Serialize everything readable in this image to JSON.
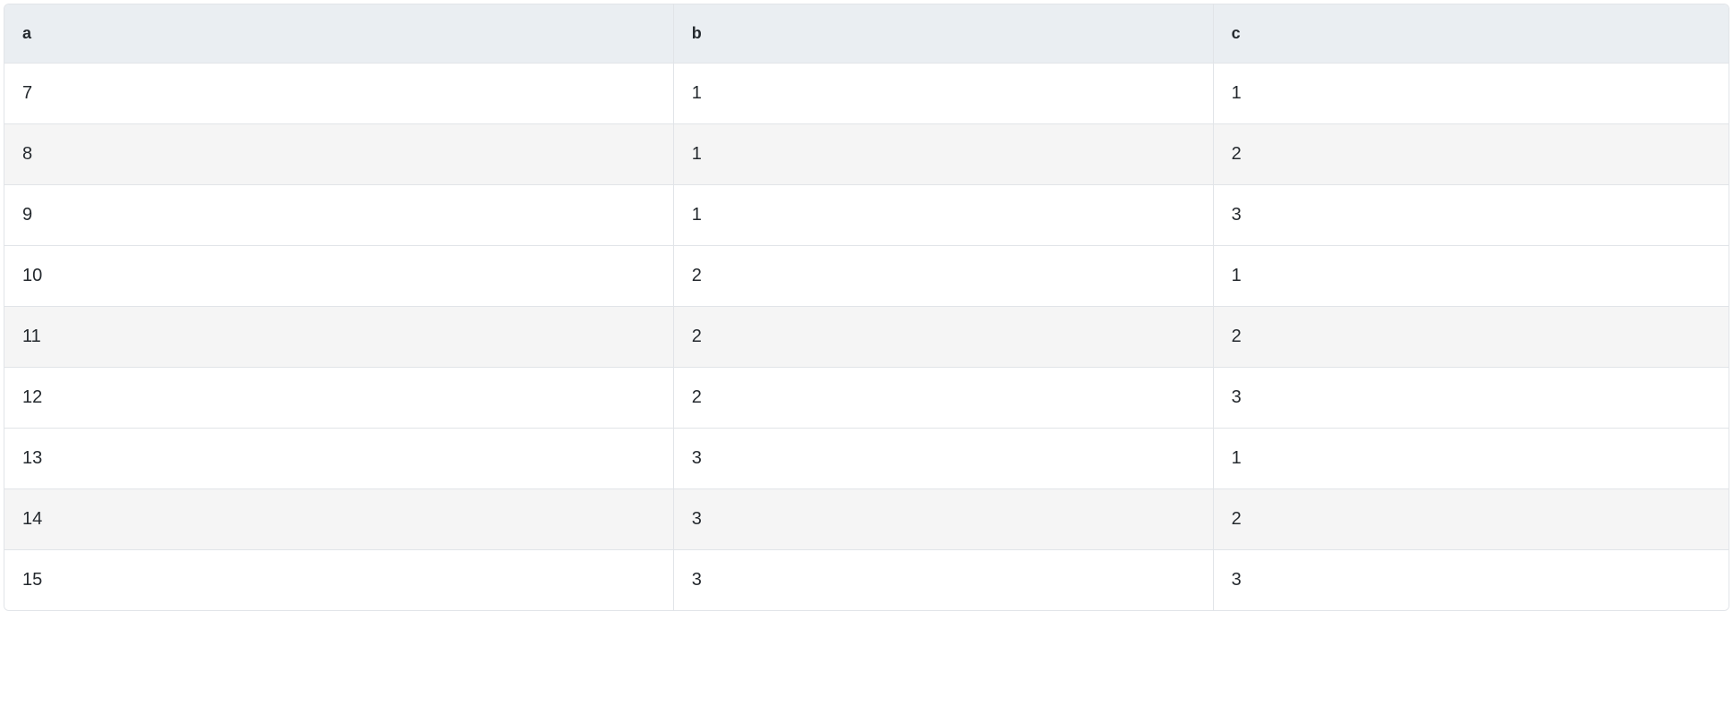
{
  "table": {
    "columns": [
      "a",
      "b",
      "c"
    ],
    "rows": [
      {
        "a": "7",
        "b": "1",
        "c": "1",
        "shaded": false
      },
      {
        "a": "8",
        "b": "1",
        "c": "2",
        "shaded": true
      },
      {
        "a": "9",
        "b": "1",
        "c": "3",
        "shaded": false
      },
      {
        "a": "10",
        "b": "2",
        "c": "1",
        "shaded": false
      },
      {
        "a": "11",
        "b": "2",
        "c": "2",
        "shaded": true
      },
      {
        "a": "12",
        "b": "2",
        "c": "3",
        "shaded": false
      },
      {
        "a": "13",
        "b": "3",
        "c": "1",
        "shaded": false
      },
      {
        "a": "14",
        "b": "3",
        "c": "2",
        "shaded": true
      },
      {
        "a": "15",
        "b": "3",
        "c": "3",
        "shaded": false
      }
    ]
  }
}
